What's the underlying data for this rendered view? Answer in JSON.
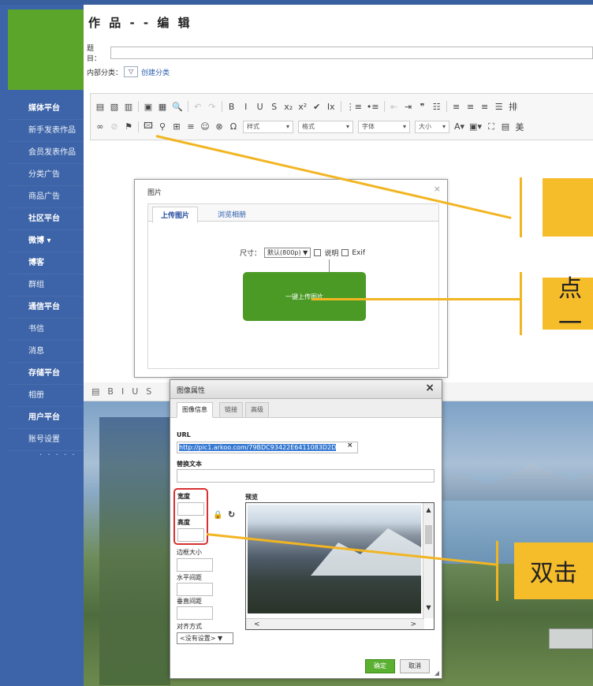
{
  "sidebar": {
    "items": [
      {
        "label": "媒体平台",
        "section": true
      },
      {
        "label": "新手发表作品",
        "section": false
      },
      {
        "label": "会员发表作品",
        "section": false
      },
      {
        "label": "分类广告",
        "section": false
      },
      {
        "label": "商品广告",
        "section": false
      },
      {
        "label": "社区平台",
        "section": true
      },
      {
        "label": "微博 ▾",
        "section": true
      },
      {
        "label": "博客",
        "section": true
      },
      {
        "label": "群组",
        "section": false
      },
      {
        "label": "通信平台",
        "section": true
      },
      {
        "label": "书信",
        "section": false
      },
      {
        "label": "消息",
        "section": false
      },
      {
        "label": "存储平台",
        "section": true
      },
      {
        "label": "相册",
        "section": false
      },
      {
        "label": "用户平台",
        "section": true
      },
      {
        "label": "账号设置",
        "section": false
      }
    ],
    "more": "· · · · ·"
  },
  "main": {
    "title": "作 品 - - 编 辑",
    "title_field_label": "题目：",
    "category_label": "内部分类：",
    "category_select": "▽",
    "create_category": "创建分类"
  },
  "toolbar": {
    "row1": [
      {
        "g": "▤",
        "dim": false
      },
      {
        "g": "▧",
        "dim": false
      },
      {
        "g": "▥",
        "dim": false
      },
      {
        "sep": true
      },
      {
        "g": "▣",
        "dim": false
      },
      {
        "g": "▦",
        "dim": false
      },
      {
        "g": "🔍",
        "dim": false
      },
      {
        "sep": true
      },
      {
        "g": "↶",
        "dim": true
      },
      {
        "g": "↷",
        "dim": true
      },
      {
        "sep": true
      },
      {
        "g": "B",
        "dim": false
      },
      {
        "g": "I",
        "dim": false
      },
      {
        "g": "U",
        "dim": false
      },
      {
        "g": "S",
        "dim": false
      },
      {
        "g": "x₂",
        "dim": false
      },
      {
        "g": "x²",
        "dim": false
      },
      {
        "g": "✔",
        "dim": false
      },
      {
        "g": "Ix",
        "dim": false
      },
      {
        "sep": true
      },
      {
        "g": "⋮≡",
        "dim": false
      },
      {
        "g": "•≡",
        "dim": false
      },
      {
        "sep": true
      },
      {
        "g": "⇤",
        "dim": true
      },
      {
        "g": "⇥",
        "dim": false
      },
      {
        "g": "❞",
        "dim": false
      },
      {
        "g": "☷",
        "dim": false
      },
      {
        "sep": true
      },
      {
        "g": "≡",
        "dim": false
      },
      {
        "g": "≡",
        "dim": false
      },
      {
        "g": "≡",
        "dim": false
      },
      {
        "g": "☰",
        "dim": false
      },
      {
        "g": "排",
        "dim": false
      }
    ],
    "row2_icons": [
      {
        "g": "∞",
        "dim": false
      },
      {
        "g": "⊘",
        "dim": true
      },
      {
        "g": "⚑",
        "dim": false
      },
      {
        "sep": true
      },
      {
        "g": "🖾",
        "dim": false
      },
      {
        "g": "⚲",
        "dim": false
      },
      {
        "g": "⊞",
        "dim": false
      },
      {
        "g": "≡",
        "dim": false
      },
      {
        "g": "☺",
        "dim": false
      },
      {
        "g": "⊗",
        "dim": false
      },
      {
        "g": "Ω",
        "dim": false
      }
    ],
    "combos": [
      {
        "label": "样式",
        "arrow": "▾"
      },
      {
        "label": "格式",
        "arrow": "▾"
      },
      {
        "label": "字体",
        "arrow": "▾"
      },
      {
        "label": "大小",
        "arrow": "▾"
      }
    ],
    "row2_tail": [
      "A▾",
      "▣▾",
      "⛶",
      "▤",
      "美"
    ]
  },
  "image_dialog": {
    "title": "图片",
    "close": "×",
    "tab_upload": "上传图片",
    "tab_browse": "浏览相册",
    "size_label": "尺寸：",
    "size_value": "默认(800p) ▼",
    "caption_label": "说明",
    "exif_label": "Exif",
    "upload_button": "一键上传图片"
  },
  "editor2_toolbar": [
    "▤",
    "B",
    "I",
    "U",
    "S"
  ],
  "props_dialog": {
    "title": "图像属性",
    "close": "×",
    "tabs": [
      "图像信息",
      "链接",
      "高级"
    ],
    "url_label": "URL",
    "url_value": "http://pic1.arkoo.com/79BDC93422E6411083D2D",
    "url_clear": "×",
    "alt_label": "替换文本",
    "width_label": "宽度",
    "height_label": "高度",
    "preview_label": "预览",
    "border_label": "边框大小",
    "hspace_label": "水平间距",
    "vspace_label": "垂直间距",
    "align_label": "对齐方式",
    "align_value": "<没有设置> ▼",
    "ok_button": "确定",
    "cancel_button": "取消",
    "scroll_up": "▲",
    "scroll_down": "▼",
    "scroll_left": "<",
    "scroll_right": ">"
  },
  "callouts": {
    "c1": "",
    "c2": "点一",
    "c3": "双击"
  },
  "colors": {
    "sidebar": "#3d64a8",
    "logo": "#5aa52a",
    "callout": "#f6bd2b",
    "upload_button": "#4a9a25",
    "highlight": "#d7312f"
  }
}
